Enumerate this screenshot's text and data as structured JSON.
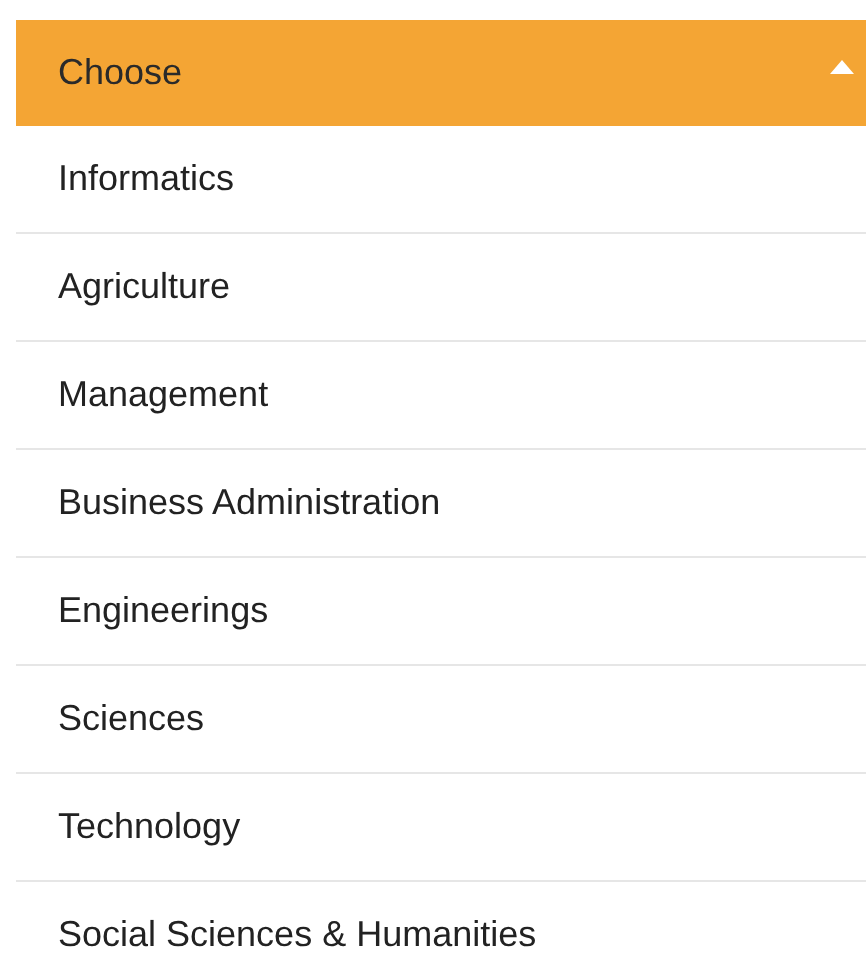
{
  "dropdown": {
    "label": "Choose",
    "expanded": true,
    "options": [
      {
        "label": "Informatics"
      },
      {
        "label": "Agriculture"
      },
      {
        "label": "Management"
      },
      {
        "label": "Business Administration"
      },
      {
        "label": "Engineerings"
      },
      {
        "label": "Sciences"
      },
      {
        "label": "Technology"
      },
      {
        "label": "Social Sciences & Humanities"
      }
    ]
  }
}
